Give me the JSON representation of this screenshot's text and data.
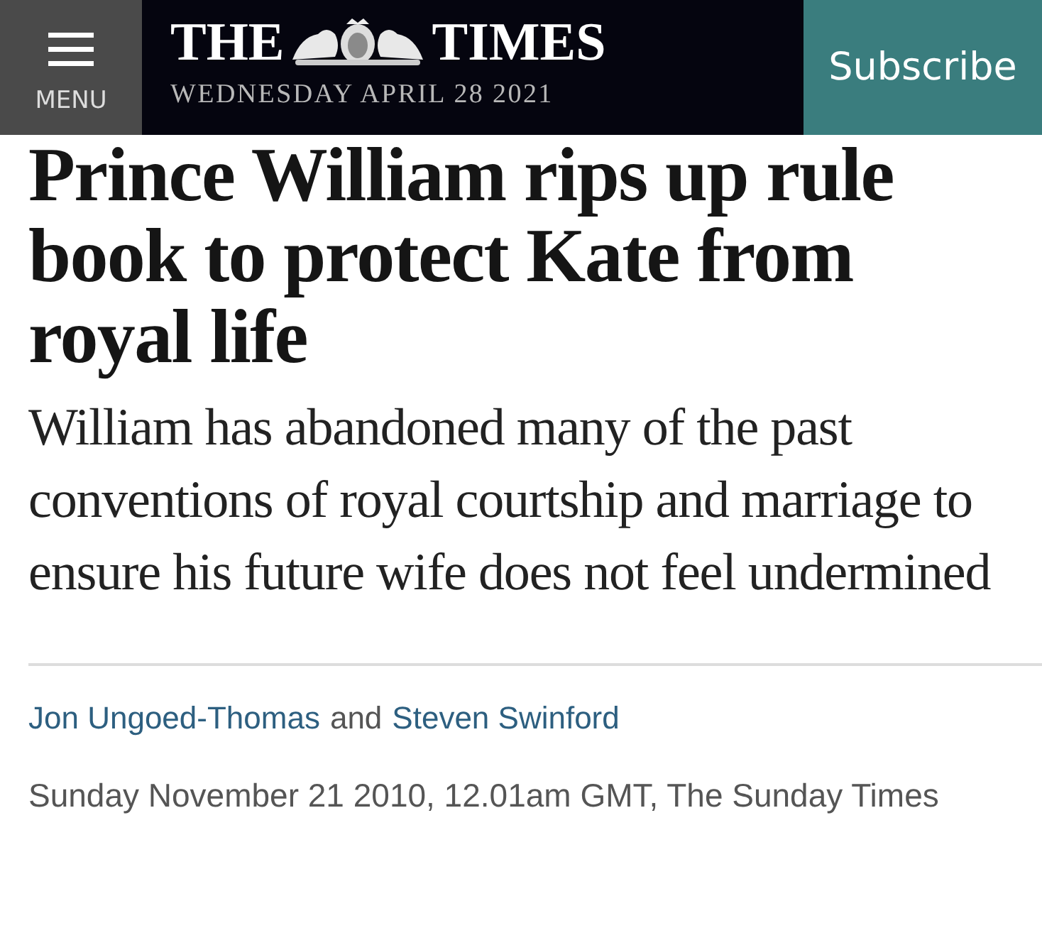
{
  "header": {
    "menu_label": "MENU",
    "masthead_left": "THE",
    "masthead_right": "TIMES",
    "date": "WEDNESDAY APRIL 28 2021",
    "subscribe": "Subscribe"
  },
  "article": {
    "headline": "Prince William rips up rule book to protect Kate from royal life",
    "standfirst": "William has abandoned many of the past conventions of royal courtship and marriage to ensure his future wife does not feel undermined",
    "byline": {
      "authors": [
        "Jon Ungoed-Thomas",
        "Steven Swinford"
      ],
      "joiner": "and"
    },
    "dateline": "Sunday November 21 2010, 12.01am GMT, The Sunday Times"
  }
}
